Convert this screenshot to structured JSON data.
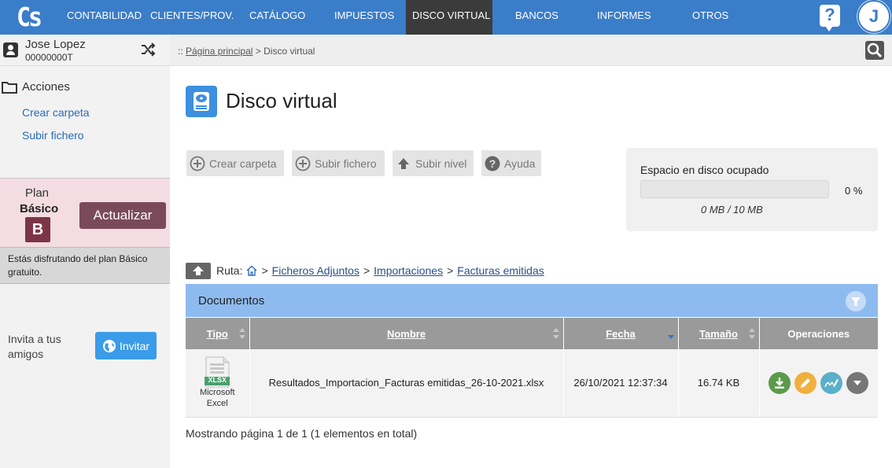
{
  "nav": {
    "logo": "Cs",
    "items": [
      "CONTABILIDAD",
      "CLIENTES/PROV.",
      "CATÁLOGO",
      "IMPUESTOS",
      "DISCO VIRTUAL",
      "BANCOS",
      "INFORMES",
      "OTROS"
    ],
    "active": "DISCO VIRTUAL",
    "help": "?",
    "avatar": "J"
  },
  "user": {
    "name": "Jose Lopez",
    "id": "00000000T"
  },
  "sidebar": {
    "actions_title": "Acciones",
    "links": [
      "Crear carpeta",
      "Subir fichero"
    ]
  },
  "plan": {
    "label": "Plan",
    "name": "Básico",
    "badge": "B",
    "upgrade": "Actualizar",
    "note": "Estás disfrutando del plan Básico gratuito."
  },
  "invite": {
    "text": "Invita a tus amigos",
    "button": "Invitar"
  },
  "breadcrumb": {
    "prefix": "::",
    "home": "Página principal",
    "separator": ">",
    "current": "Disco virtual"
  },
  "page": {
    "title": "Disco virtual"
  },
  "toolbar": {
    "create_folder": "Crear carpeta",
    "upload_file": "Subir fichero",
    "up_level": "Subir nivel",
    "help": "Ayuda"
  },
  "disk": {
    "title": "Espacio en disco ocupado",
    "percent": "0 %",
    "usage": "0 MB / 10 MB",
    "fill_fraction": 0
  },
  "route": {
    "label": "Ruta:",
    "folders": [
      "Ficheros Adjuntos",
      "Importaciones",
      "Facturas emitidas"
    ]
  },
  "documents": {
    "title": "Documentos",
    "columns": [
      "Tipo",
      "Nombre",
      "Fecha",
      "Tamaño",
      "Operaciones"
    ],
    "rows": [
      {
        "icon_label": "XLSX",
        "type": "Microsoft Excel",
        "name": "Resultados_Importacion_Facturas emitidas_26-10-2021.xlsx",
        "date": "26/10/2021 12:37:34",
        "size": "16.74 KB"
      }
    ]
  },
  "pager": "Mostrando página 1 de 1 (1 elementos en total)",
  "colors": {
    "nav_bg": "#3a7dc9",
    "nav_active": "#3b3b3b",
    "plan_badge": "#7b3547",
    "docs_header": "#8ebbef",
    "table_header": "#9a9a9a",
    "download": "#5a9a4a",
    "edit": "#f0b040",
    "sign": "#5ab0c8",
    "more": "#777777"
  }
}
